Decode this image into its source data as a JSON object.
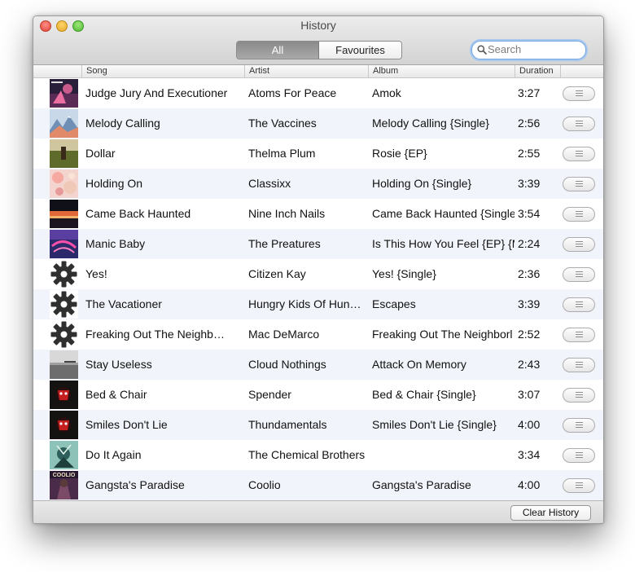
{
  "window": {
    "title": "History"
  },
  "filter": {
    "all_label": "All",
    "favourites_label": "Favourites",
    "selected": "All"
  },
  "search": {
    "placeholder": "Search",
    "value": ""
  },
  "columns": {
    "song": "Song",
    "artist": "Artist",
    "album": "Album",
    "duration": "Duration"
  },
  "rows": [
    {
      "song": "Judge Jury And Executioner",
      "artist": "Atoms For Peace",
      "album": "Amok",
      "duration": "3:27",
      "art": "art-amok"
    },
    {
      "song": "Melody Calling",
      "artist": "The Vaccines",
      "album": "Melody Calling {Single}",
      "duration": "2:56",
      "art": "art-mountains"
    },
    {
      "song": "Dollar",
      "artist": "Thelma Plum",
      "album": "Rosie {EP}",
      "duration": "2:55",
      "art": "art-field"
    },
    {
      "song": "Holding On",
      "artist": "Classixx",
      "album": "Holding On {Single}",
      "duration": "3:39",
      "art": "art-pastel"
    },
    {
      "song": "Came Back Haunted",
      "artist": "Nine Inch Nails",
      "album": "Came Back Haunted {Single}",
      "duration": "3:54",
      "art": "art-sunset"
    },
    {
      "song": "Manic Baby",
      "artist": "The Preatures",
      "album": "Is This How You Feel {EP} {M",
      "duration": "2:24",
      "art": "art-purple"
    },
    {
      "song": "Yes!",
      "artist": "Citizen Kay",
      "album": "Yes! {Single}",
      "duration": "2:36",
      "art": "gear-icon"
    },
    {
      "song": "The Vacationer",
      "artist": "Hungry Kids Of Hun…",
      "album": "Escapes",
      "duration": "3:39",
      "art": "gear-icon"
    },
    {
      "song": "Freaking Out The Neighb…",
      "artist": "Mac DeMarco",
      "album": "Freaking Out The Neighborl",
      "duration": "2:52",
      "art": "gear-icon"
    },
    {
      "song": "Stay Useless",
      "artist": "Cloud Nothings",
      "album": "Attack On Memory",
      "duration": "2:43",
      "art": "art-grey"
    },
    {
      "song": "Bed & Chair",
      "artist": "Spender",
      "album": "Bed & Chair {Single}",
      "duration": "3:07",
      "art": "art-red-dark"
    },
    {
      "song": "Smiles Don't Lie",
      "artist": "Thundamentals",
      "album": "Smiles Don't Lie {Single}",
      "duration": "4:00",
      "art": "art-red-dark"
    },
    {
      "song": "Do It Again",
      "artist": "The Chemical Brothers",
      "album": "",
      "duration": "3:34",
      "art": "art-teal"
    },
    {
      "song": "Gangsta's Paradise",
      "artist": "Coolio",
      "album": "Gangsta's Paradise",
      "duration": "4:00",
      "art": "art-coolio",
      "art_text": "COOLIO"
    }
  ],
  "footer": {
    "clear_label": "Clear History"
  }
}
